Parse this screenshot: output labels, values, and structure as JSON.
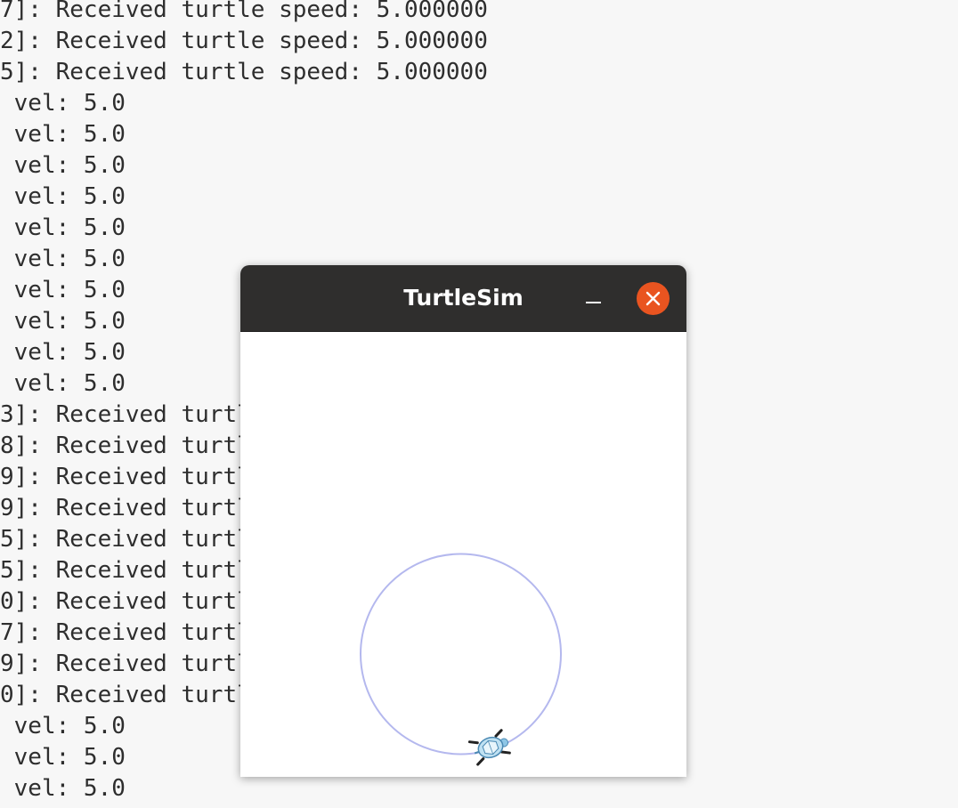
{
  "terminal": {
    "lines": [
      "7]: Received turtle speed: 5.000000",
      "2]: Received turtle speed: 5.000000",
      "5]: Received turtle speed: 5.000000",
      " vel: 5.0",
      " vel: 5.0",
      " vel: 5.0",
      " vel: 5.0",
      " vel: 5.0",
      " vel: 5.0",
      " vel: 5.0",
      " vel: 5.0",
      " vel: 5.0",
      " vel: 5.0",
      "3]: Received turtle speed: 5.000000",
      "8]: Received turtle speed: 5.000000",
      "9]: Received turtle speed: 5.000000",
      "9]: Received turtle speed: 5.000000",
      "5]: Received turtle speed: 5.000000",
      "5]: Received turtle speed: 5.000000",
      "0]: Received turtle speed: 5.000000",
      "7]: Received turtle speed: 5.000000",
      "9]: Received turtle speed: 5.000000",
      "0]: Received turtle speed: 5.000000",
      " vel: 5.0",
      " vel: 5.0",
      " vel: 5.0"
    ]
  },
  "window": {
    "title": "TurtleSim",
    "minimize_icon": "minimize-icon",
    "close_icon": "close-icon",
    "close_color": "#e95420",
    "titlebar_color": "#2f2e2d"
  },
  "canvas": {
    "background": "#ffffff",
    "trail_color": "#b4b8ee",
    "turtle_icon": "turtle-icon"
  }
}
